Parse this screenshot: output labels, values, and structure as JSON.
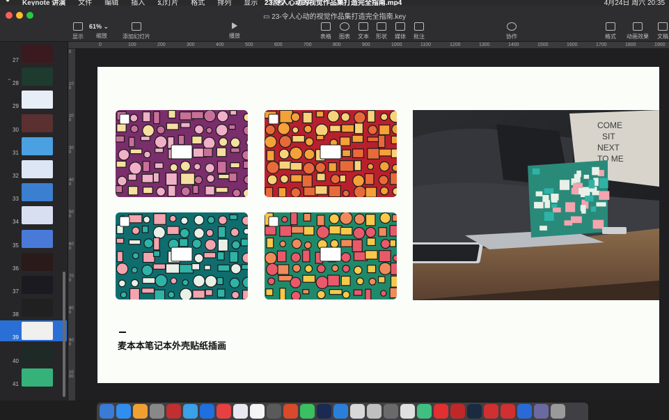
{
  "menubar": {
    "app_name": "Keynote 讲演",
    "menus": [
      "文件",
      "编辑",
      "插入",
      "幻灯片",
      "格式",
      "排列",
      "显示",
      "播放",
      "共享"
    ],
    "center_text": "23.令人心动的视觉作品集打造完全指南.mp4",
    "clock": "4月24日 周六 20:35"
  },
  "window": {
    "doc_title": "23-令人心动的视觉作品集打造完全指南.key",
    "zoom": "61%",
    "toolbar": {
      "view": "显示",
      "zoom": "缩放",
      "add_slide": "添加幻灯片",
      "play": "播放",
      "table": "表格",
      "chart": "图表",
      "text": "文本",
      "shape": "形状",
      "media": "媒体",
      "comment": "批注",
      "collaborate": "协作",
      "format": "格式",
      "animate": "动画效果",
      "document": "文稿"
    }
  },
  "ruler": {
    "top": [
      "0",
      "100",
      "200",
      "300",
      "400",
      "500",
      "600",
      "700",
      "800",
      "900",
      "1000",
      "1100",
      "1200",
      "1300",
      "1400",
      "1500",
      "1600",
      "1700",
      "1800",
      "1900"
    ],
    "left": [
      "0",
      "100",
      "200",
      "300",
      "400",
      "500",
      "600",
      "700",
      "800",
      "900",
      "1000"
    ]
  },
  "sidebar": {
    "slides": [
      {
        "num": "27",
        "bg": "#3a1a1f"
      },
      {
        "num": "28",
        "bg": "#1f3a2f"
      },
      {
        "num": "29",
        "bg": "#e8eef8"
      },
      {
        "num": "30",
        "bg": "#5a3030"
      },
      {
        "num": "31",
        "bg": "#4aa0e0"
      },
      {
        "num": "32",
        "bg": "#dde6f5"
      },
      {
        "num": "33",
        "bg": "#3b7fd0"
      },
      {
        "num": "34",
        "bg": "#d8dff0"
      },
      {
        "num": "35",
        "bg": "#4a7ad8"
      },
      {
        "num": "36",
        "bg": "#2a1a1a"
      },
      {
        "num": "37",
        "bg": "#1a1a20"
      },
      {
        "num": "38",
        "bg": "#202020"
      },
      {
        "num": "39",
        "bg": "#f0f0ee"
      },
      {
        "num": "40",
        "bg": "#1e2a26"
      },
      {
        "num": "41",
        "bg": "#35b27a"
      }
    ],
    "selected": "39"
  },
  "slide": {
    "caption": "麦本本笔记本外壳贴纸插画",
    "photo_pillow_text": "COME SIT NEXT TO ME"
  },
  "colors": {
    "purple_variant": [
      "#7a2e6b",
      "#c9709a",
      "#f0b0c8",
      "#f5e0a0"
    ],
    "orange_variant": [
      "#b8202e",
      "#f3a13a",
      "#f7d27a",
      "#e86a3a"
    ],
    "teal_variant": [
      "#0f6d6e",
      "#2fb3a6",
      "#f4a4ae",
      "#e8f0e8"
    ],
    "green_variant": [
      "#1f8a6a",
      "#f08a5a",
      "#f7c84a",
      "#e85a6a"
    ]
  }
}
